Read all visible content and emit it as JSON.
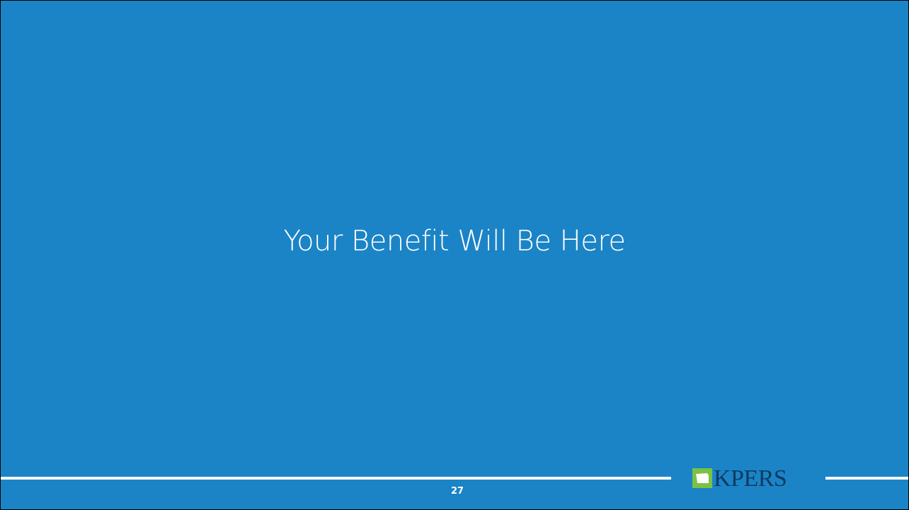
{
  "slide": {
    "title": "Your Benefit Will Be Here",
    "page_number": "27"
  },
  "logo": {
    "text": "KPERS"
  },
  "colors": {
    "background": "#1b84c6",
    "text": "#ffffff",
    "logo_text": "#0f3a63",
    "logo_green": "#7cc242"
  }
}
